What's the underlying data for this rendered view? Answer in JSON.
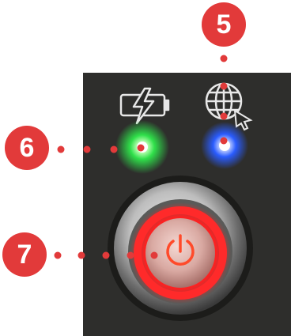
{
  "callouts": [
    {
      "label": "5"
    },
    {
      "label": "6"
    },
    {
      "label": "7"
    }
  ],
  "icons": {
    "charge": "battery-charging-icon",
    "network": "globe-cursor-icon",
    "power": "power-icon"
  },
  "colors": {
    "callout": "#E23A3A",
    "panel": "#2a2a28",
    "led_green": "#2fe04a",
    "led_blue": "#2a5cff",
    "button_ring": "#ff2a2a",
    "bezel": "#c9c9c9"
  }
}
